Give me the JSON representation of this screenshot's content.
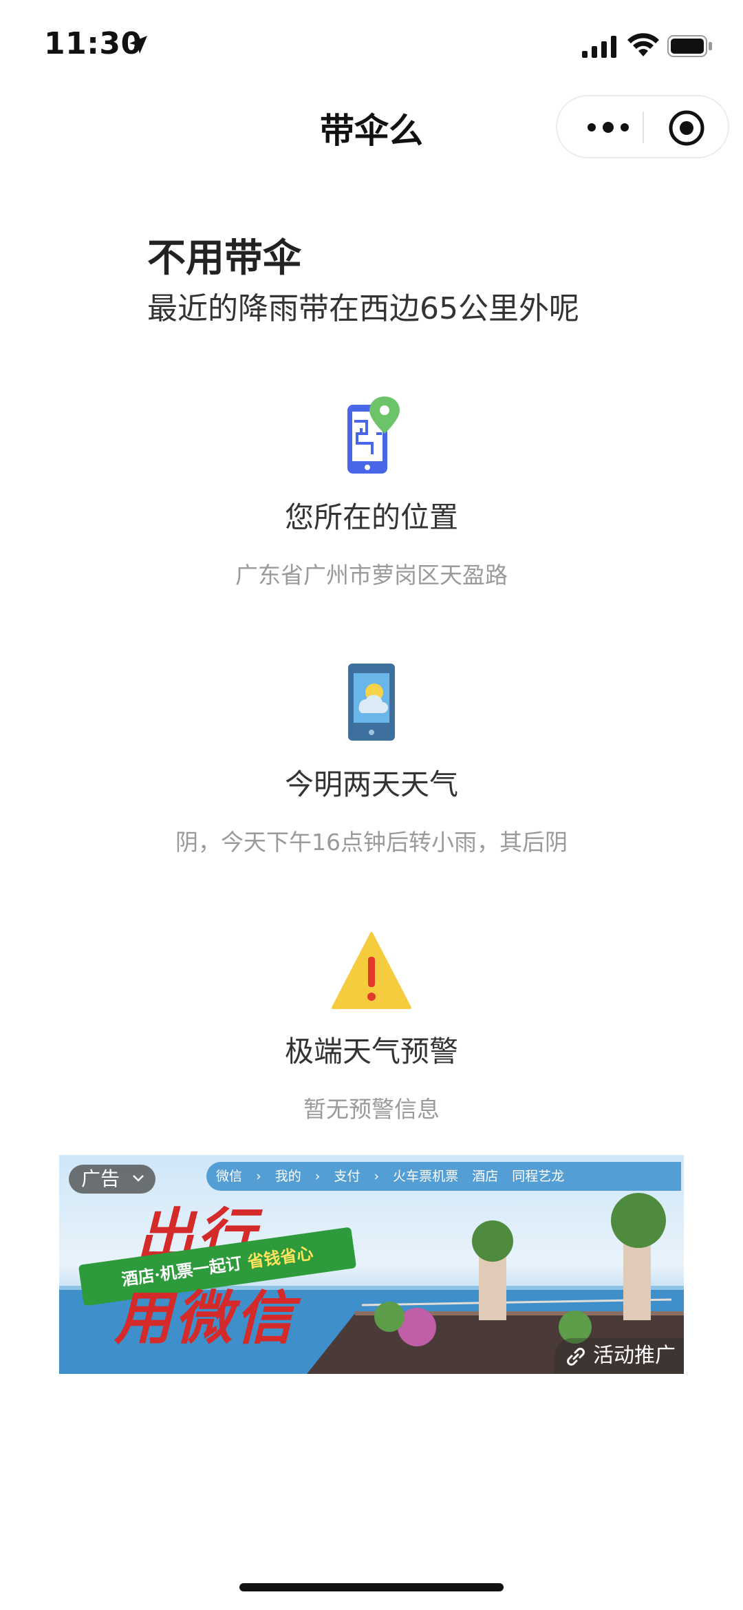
{
  "status_bar": {
    "time": "11:30"
  },
  "nav": {
    "title": "带伞么"
  },
  "result": {
    "headline": "不用带伞",
    "detail": "最近的降雨带在西边65公里外呢"
  },
  "sections": [
    {
      "icon": "phone-map-pin-icon",
      "title": "您所在的位置",
      "desc": "广东省广州市萝岗区天盈路"
    },
    {
      "icon": "phone-weather-icon",
      "title": "今明两天天气",
      "desc": "阴，今天下午16点钟后转小雨，其后阴"
    },
    {
      "icon": "warning-triangle-icon",
      "title": "极端天气预警",
      "desc": "暂无预警信息"
    }
  ],
  "ad": {
    "tag": "广告",
    "topbar": [
      "微信",
      "我的",
      "支付",
      "火车票机票",
      "酒店",
      "同程艺龙"
    ],
    "slogan_line1": "出行",
    "slogan_line2": "用微信",
    "ribbon_text": "酒店·机票一起订",
    "ribbon_highlight": "省钱省心",
    "promo_label": "活动推广"
  },
  "colors": {
    "accent_blue": "#4a66e8",
    "pin_green": "#6cc36a",
    "warning_yellow": "#f5cc3d",
    "warning_red": "#e23b2e"
  }
}
